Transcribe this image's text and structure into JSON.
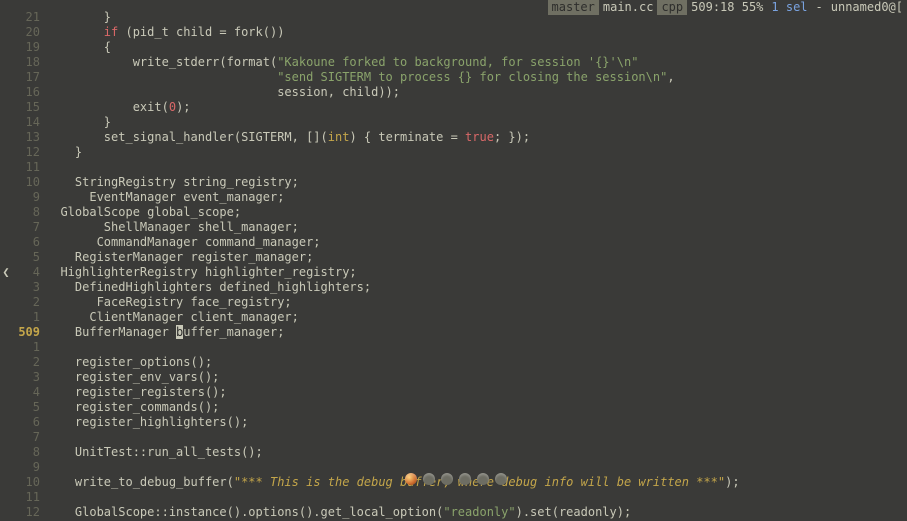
{
  "status": {
    "branch": "master",
    "file": "main.cc",
    "filetype": "cpp",
    "position": "509:18 55%",
    "selection": "1 sel",
    "dash": "-",
    "client": "unnamed0@["
  },
  "cursor_line": "509",
  "lines": [
    {
      "n": "21",
      "segs": [
        {
          "t": "        }",
          "c": ""
        }
      ]
    },
    {
      "n": "20",
      "segs": [
        {
          "t": "        ",
          "c": ""
        },
        {
          "t": "if",
          "c": "kw"
        },
        {
          "t": " (pid_t child = fork())",
          "c": ""
        }
      ]
    },
    {
      "n": "19",
      "segs": [
        {
          "t": "        {",
          "c": ""
        }
      ]
    },
    {
      "n": "18",
      "segs": [
        {
          "t": "            write_stderr(format(",
          "c": ""
        },
        {
          "t": "\"Kakoune forked to background, for session '{}'\\n\"",
          "c": "str"
        }
      ]
    },
    {
      "n": "17",
      "segs": [
        {
          "t": "                                ",
          "c": ""
        },
        {
          "t": "\"send SIGTERM to process {} for closing the session\\n\"",
          "c": "str"
        },
        {
          "t": ",",
          "c": ""
        }
      ]
    },
    {
      "n": "16",
      "segs": [
        {
          "t": "                                session, child));",
          "c": ""
        }
      ]
    },
    {
      "n": "15",
      "segs": [
        {
          "t": "            exit(",
          "c": ""
        },
        {
          "t": "0",
          "c": "num"
        },
        {
          "t": ");",
          "c": ""
        }
      ]
    },
    {
      "n": "14",
      "segs": [
        {
          "t": "        }",
          "c": ""
        }
      ]
    },
    {
      "n": "13",
      "segs": [
        {
          "t": "        set_signal_handler(SIGTERM, [](",
          "c": ""
        },
        {
          "t": "int",
          "c": "ty"
        },
        {
          "t": ") { terminate = ",
          "c": ""
        },
        {
          "t": "true",
          "c": "kw"
        },
        {
          "t": "; });",
          "c": ""
        }
      ]
    },
    {
      "n": "12",
      "segs": [
        {
          "t": "    }",
          "c": ""
        }
      ]
    },
    {
      "n": "11",
      "segs": [
        {
          "t": "",
          "c": ""
        }
      ]
    },
    {
      "n": "10",
      "segs": [
        {
          "t": "    StringRegistry string_registry;",
          "c": ""
        }
      ]
    },
    {
      "n": "9",
      "segs": [
        {
          "t": "      EventManager event_manager;",
          "c": ""
        }
      ]
    },
    {
      "n": "8",
      "segs": [
        {
          "t": "  GlobalScope global_scope;",
          "c": ""
        }
      ]
    },
    {
      "n": "7",
      "segs": [
        {
          "t": "        ShellManager shell_manager;",
          "c": ""
        }
      ]
    },
    {
      "n": "6",
      "segs": [
        {
          "t": "       CommandManager command_manager;",
          "c": ""
        }
      ]
    },
    {
      "n": "5",
      "segs": [
        {
          "t": "    RegisterManager register_manager;",
          "c": ""
        }
      ]
    },
    {
      "n": "4",
      "wrap": true,
      "segs": [
        {
          "t": "  HighlighterRegistry highlighter_registry;",
          "c": ""
        }
      ]
    },
    {
      "n": "3",
      "segs": [
        {
          "t": "    DefinedHighlighters defined_highlighters;",
          "c": ""
        }
      ]
    },
    {
      "n": "2",
      "segs": [
        {
          "t": "       FaceRegistry face_registry;",
          "c": ""
        }
      ]
    },
    {
      "n": "1",
      "segs": [
        {
          "t": "      ClientManager client_manager;",
          "c": ""
        }
      ]
    },
    {
      "n": "509",
      "current": true,
      "segs": [
        {
          "t": "    BufferManager ",
          "c": ""
        },
        {
          "t": "b",
          "c": "cursor"
        },
        {
          "t": "uffer_manager;",
          "c": ""
        }
      ]
    },
    {
      "n": "1",
      "segs": [
        {
          "t": "",
          "c": ""
        }
      ]
    },
    {
      "n": "2",
      "segs": [
        {
          "t": "    register_options();",
          "c": ""
        }
      ]
    },
    {
      "n": "3",
      "segs": [
        {
          "t": "    register_env_vars();",
          "c": ""
        }
      ]
    },
    {
      "n": "4",
      "segs": [
        {
          "t": "    register_registers();",
          "c": ""
        }
      ]
    },
    {
      "n": "5",
      "segs": [
        {
          "t": "    register_commands();",
          "c": ""
        }
      ]
    },
    {
      "n": "6",
      "segs": [
        {
          "t": "    register_highlighters();",
          "c": ""
        }
      ]
    },
    {
      "n": "7",
      "segs": [
        {
          "t": "",
          "c": ""
        }
      ]
    },
    {
      "n": "8",
      "segs": [
        {
          "t": "    UnitTest::run_all_tests();",
          "c": ""
        }
      ]
    },
    {
      "n": "9",
      "segs": [
        {
          "t": "",
          "c": ""
        }
      ]
    },
    {
      "n": "10",
      "segs": [
        {
          "t": "    write_to_debug_buffer(",
          "c": ""
        },
        {
          "t": "\"*** This is the debug buffer, where debug info will be written ***\"",
          "c": "str2"
        },
        {
          "t": ");",
          "c": ""
        }
      ]
    },
    {
      "n": "11",
      "segs": [
        {
          "t": "",
          "c": ""
        }
      ]
    },
    {
      "n": "12",
      "segs": [
        {
          "t": "    GlobalScope::instance().options().get_local_option(",
          "c": ""
        },
        {
          "t": "\"readonly\"",
          "c": "str"
        },
        {
          "t": ").set(readonly);",
          "c": ""
        }
      ]
    }
  ]
}
